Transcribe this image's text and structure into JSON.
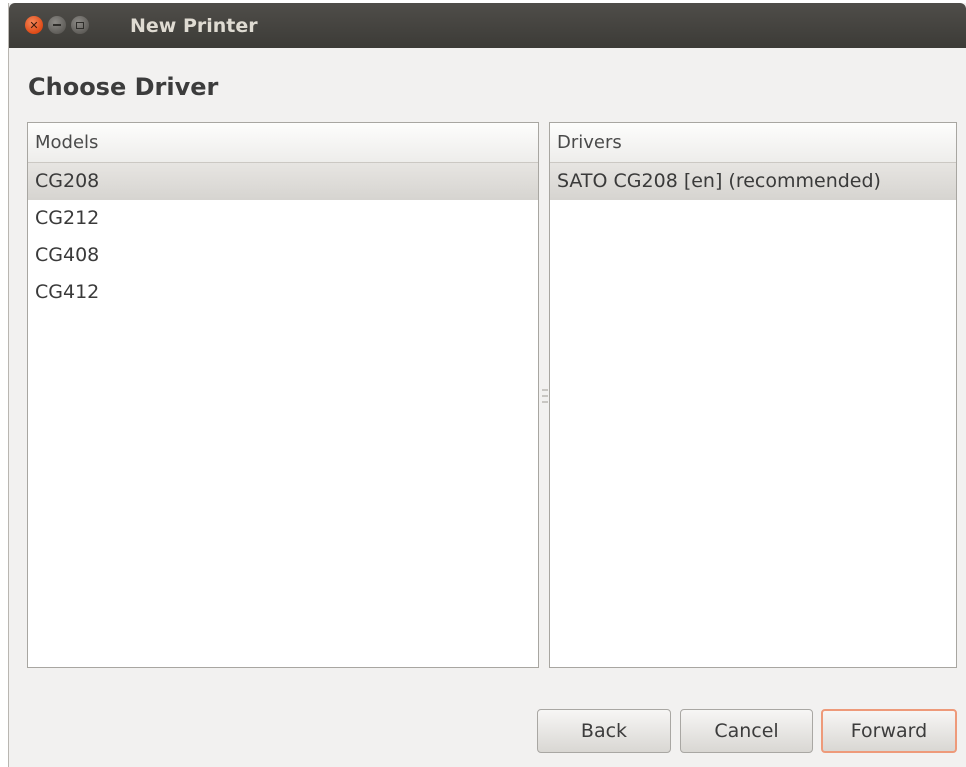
{
  "window": {
    "title": "New Printer"
  },
  "page": {
    "heading": "Choose Driver"
  },
  "models": {
    "header": "Models",
    "items": [
      "CG208",
      "CG212",
      "CG408",
      "CG412"
    ],
    "selected": "CG208"
  },
  "drivers": {
    "header": "Drivers",
    "items": [
      "SATO CG208 [en] (recommended)"
    ],
    "selected": "SATO CG208 [en] (recommended)"
  },
  "buttons": {
    "back": "Back",
    "cancel": "Cancel",
    "forward": "Forward"
  },
  "colors": {
    "close_button": "#df4a16",
    "default_button_border": "#ee9a7a",
    "titlebar": "#3c3b37"
  }
}
